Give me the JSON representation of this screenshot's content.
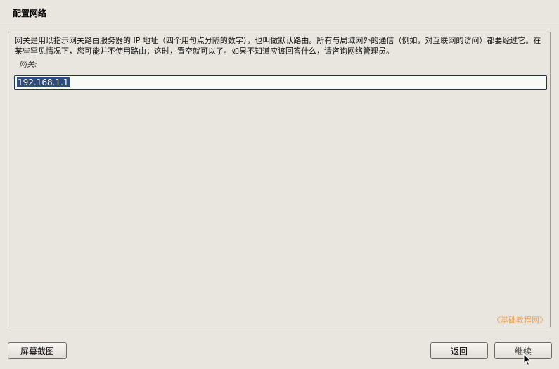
{
  "header": {
    "title": "配置网络"
  },
  "main": {
    "description": "网关是用以指示网关路由服务器的 IP 地址（四个用句点分隔的数字），也叫做默认路由。所有与局域网外的通信（例如，对互联网的访问）都要经过它。在某些罕见情况下，您可能并不使用路由；这时，置空就可以了。如果不知道应该回答什么，请咨询网络管理员。",
    "gateway_label": "网关:",
    "gateway_value": "192.168.1.1",
    "watermark": "《基础教程网》"
  },
  "buttons": {
    "screenshot": "屏幕截图",
    "back": "返回",
    "continue": "继续"
  },
  "icons": {
    "cursor": "mouse-pointer-icon"
  }
}
